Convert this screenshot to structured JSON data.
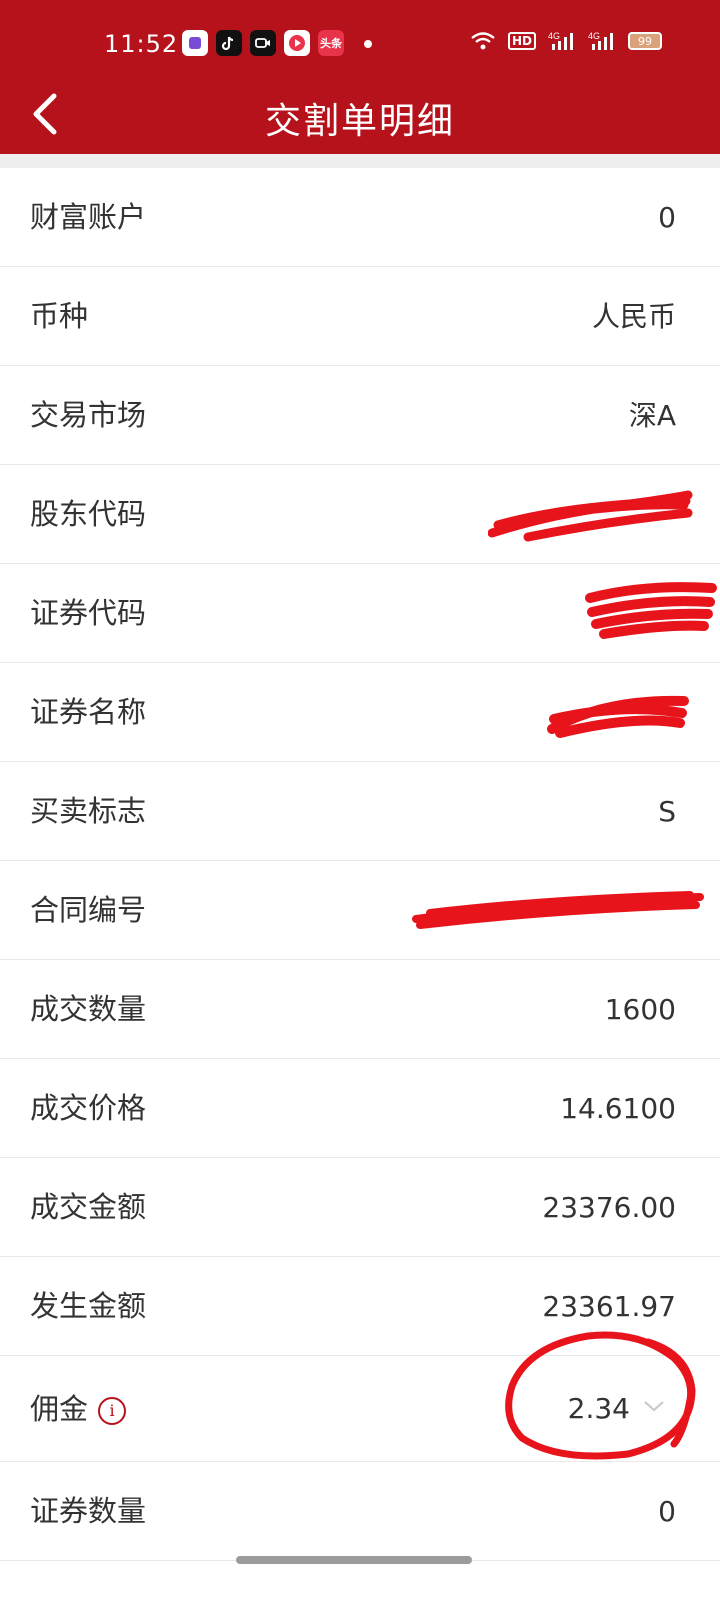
{
  "status_bar": {
    "time": "11:52",
    "battery": "99",
    "icons": [
      "screen-record-icon",
      "tiktok-icon",
      "camera-icon",
      "video-icon",
      "toutiao-icon",
      "wifi-icon",
      "hd-icon",
      "signal-4g-icon",
      "signal-4g-icon",
      "battery-icon"
    ],
    "toutiao_text": "头条",
    "hd_text": "HD"
  },
  "header": {
    "title": "交割单明细"
  },
  "rows": [
    {
      "label": "财富账户",
      "value": "0"
    },
    {
      "label": "币种",
      "value": "人民币"
    },
    {
      "label": "交易市场",
      "value": "深A"
    },
    {
      "label": "股东代码",
      "value": ""
    },
    {
      "label": "证券代码",
      "value": ""
    },
    {
      "label": "证券名称",
      "value": ""
    },
    {
      "label": "买卖标志",
      "value": "S"
    },
    {
      "label": "合同编号",
      "value": ""
    },
    {
      "label": "成交数量",
      "value": "1600"
    },
    {
      "label": "成交价格",
      "value": "14.6100"
    },
    {
      "label": "成交金额",
      "value": "23376.00"
    },
    {
      "label": "发生金额",
      "value": "23361.97"
    },
    {
      "label": "佣金",
      "value": "2.34"
    },
    {
      "label": "证券数量",
      "value": "0"
    }
  ],
  "colors": {
    "brand_red": "#b5121b",
    "text": "#333333",
    "divider": "#e9e9e9"
  }
}
